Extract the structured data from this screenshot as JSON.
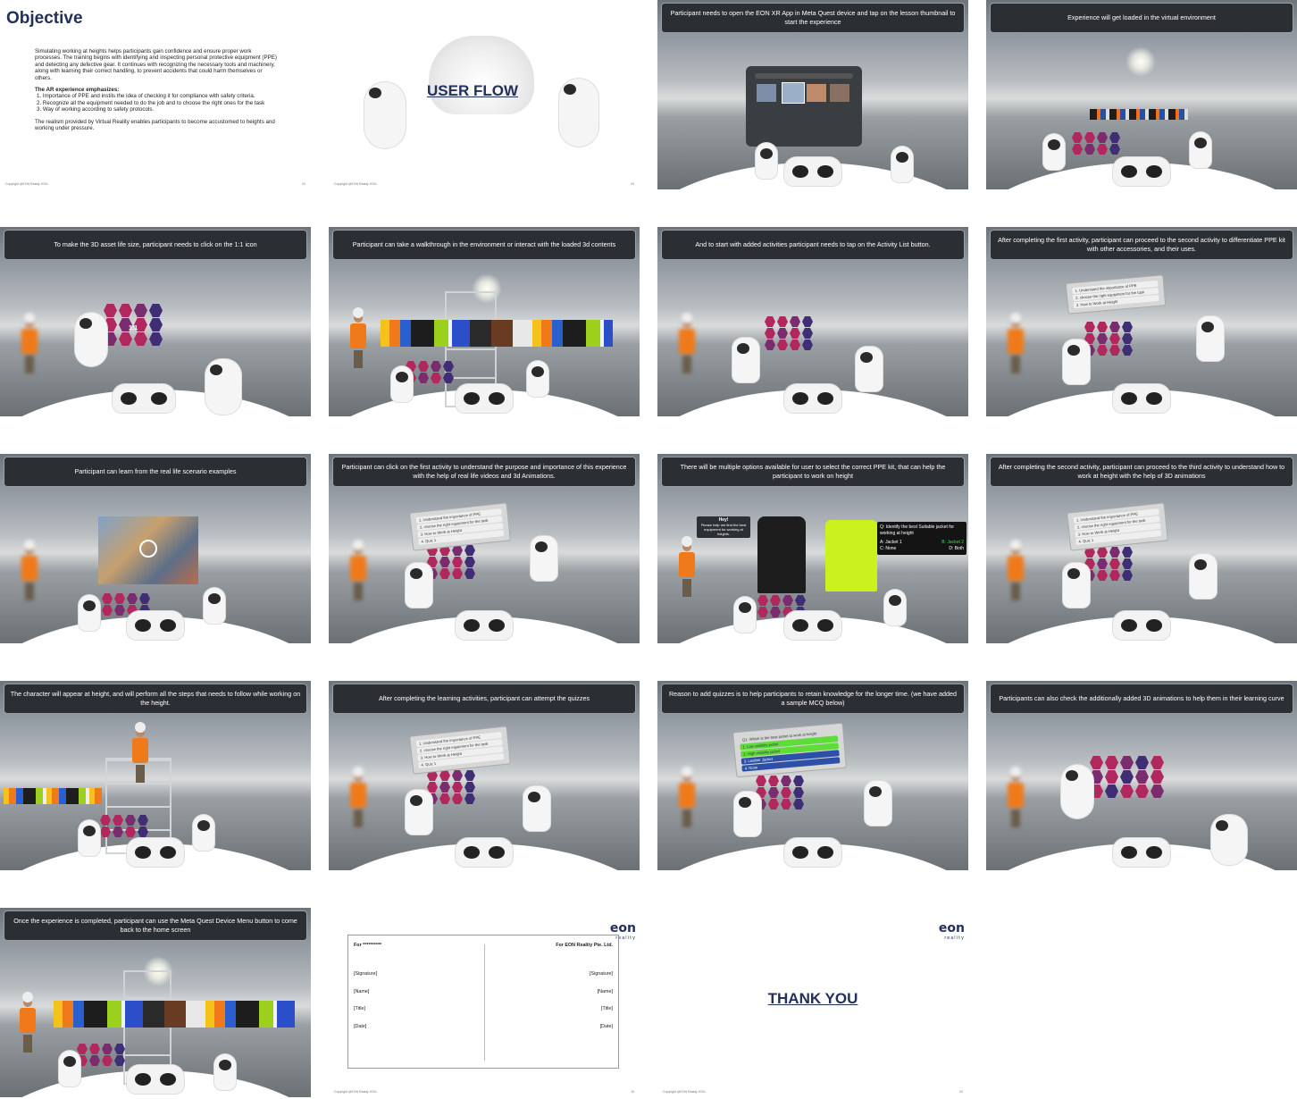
{
  "objective": {
    "title": "Objective",
    "intro": "Simulating working at heights helps participants gain confidence and ensure proper work processes. The training begins with identifying and inspecting personal protective equipment (PPE) and detecting any defective gear. It continues with recognizing the necessary tools and machinery, along with learning their correct handling, to prevent accidents that could harm themselves or others.",
    "emph_title": "The AR experience emphasizes:",
    "points": [
      "1. Importance of PPE and instils the idea of checking it for compliance with safety criteria.",
      "2. Recognize all the equipment needed to do the job and to choose the right ones for the task",
      "3. Way of working according to safety protocols."
    ],
    "closing": "The realism provided by Virtual Reality enables participants to become accustomed to heights and working under pressure.",
    "footer": "Copyright @EON Reality 2024",
    "page": "02"
  },
  "userflow": {
    "title": "USER FLOW",
    "footer": "Copyright @EON Reality 2024",
    "page": "03"
  },
  "steps": [
    "Participant needs to open the EON XR App in Meta Quest device and tap on the lesson thumbnail to start the experience",
    "Experience will get loaded in the virtual environment",
    "To make the 3D asset life size, participant needs to click on the 1:1 icon",
    "Participant can take a walkthrough in the environment or interact with the loaded 3d contents",
    "And to start with added activities participant needs to tap on the Activity List button.",
    "After completing the first activity, participant can proceed to the second activity to differentiate PPE kit with other accessories, and their uses.",
    "Participant can learn from the real life scenario examples",
    "Participant can click on the first activity to understand the purpose and importance of this experience with the help of real life videos and 3d Animations.",
    "There will be multiple options available for user to select the correct PPE kit, that can help the participant to work on height",
    "After completing the second activity, participant can proceed to the third activity to understand how to work at height with the help of 3D animations",
    "The character will appear at height, and will perform all the steps that needs to follow while working on the height.",
    "After completing the learning activities, participant can attempt the quizzes",
    "Reason to add quizzes is to help participants to retain knowledge for the longer time. (we have added a sample MCQ below)",
    "Participants can also check the additionally added 3D animations to help them in their learning curve",
    "Once the experience is completed, participant can use the Meta Quest Device Menu button to come back to the home screen"
  ],
  "activity_list": [
    "1. Understand the importance of PPE",
    "2. choose the right equipment for the task",
    "3. How to Work at Height",
    "4. Quiz 1"
  ],
  "ppe_question": {
    "bubble_title": "Hey!",
    "bubble_text": "Please help me find the best equipment for working at heights.",
    "question": "Q: Identify the best Suitable jacket for working at height",
    "a": "A: Jacket 1",
    "b": "B: Jacket 2",
    "c": "C: None",
    "d": "D: Both"
  },
  "mcq": {
    "question": "Q1. Which is the best jacket to work at height",
    "options": [
      "1. Low visibility jacket",
      "2. High visibility jacket",
      "3. Leather Jacket",
      "4. None"
    ]
  },
  "one_to_one": "1:1",
  "signature": {
    "left_head": "For **********",
    "right_head": "For EON Reality Pte. Ltd.",
    "fields": [
      "[Signature]",
      "[Name]",
      "[Title]",
      "[Date]"
    ],
    "footer": "Copyright @EON Reality 2024",
    "page": "19"
  },
  "thanks": {
    "title": "THANK YOU",
    "footer": "Copyright @EON Reality 2024",
    "page": "20"
  },
  "logo": {
    "word": "eon",
    "sub": "reality"
  },
  "colors": {
    "navy": "#22305a",
    "banner": "#2b2f33",
    "magenta": "#b0285d",
    "purple": "#3f2e73"
  }
}
